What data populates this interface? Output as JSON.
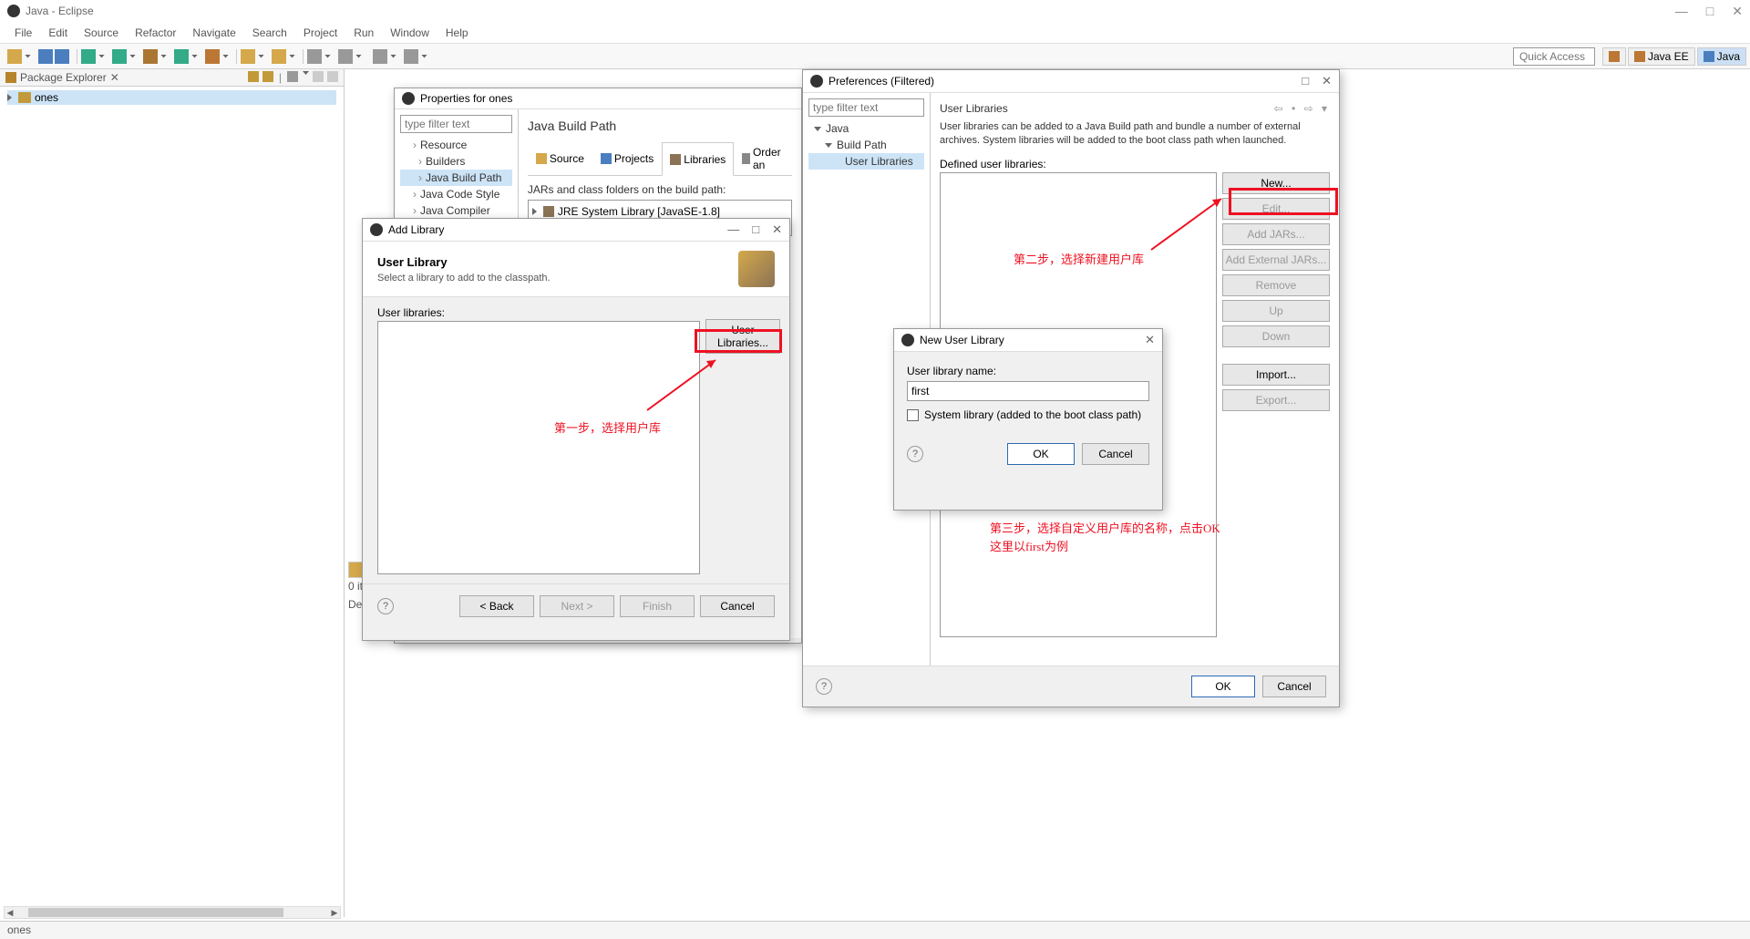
{
  "window": {
    "title": "Java - Eclipse",
    "minimize": "—",
    "maximize": "□",
    "close": "✕"
  },
  "menubar": {
    "items": [
      "File",
      "Edit",
      "Source",
      "Refactor",
      "Navigate",
      "Search",
      "Project",
      "Run",
      "Window",
      "Help"
    ]
  },
  "toolbar": {
    "quick_access": "Quick Access",
    "perspectives": {
      "javaee": "Java EE",
      "java": "Java"
    }
  },
  "package_explorer": {
    "title": "Package Explorer",
    "close_char": "✕",
    "project": "ones"
  },
  "properties_dialog": {
    "title": "Properties for ones",
    "filter_placeholder": "type filter text",
    "tree": {
      "resource": "Resource",
      "builders": "Builders",
      "build_path": "Java Build Path",
      "code_style": "Java Code Style",
      "compiler": "Java Compiler"
    },
    "heading": "Java Build Path",
    "tabs": {
      "source": "Source",
      "projects": "Projects",
      "libraries": "Libraries",
      "order": "Order an"
    },
    "desc": "JARs and class folders on the build path:",
    "jre": "JRE System Library [JavaSE-1.8]"
  },
  "add_library_dialog": {
    "title": "Add Library",
    "heading": "User Library",
    "subheading": "Select a library to add to the classpath.",
    "list_label": "User libraries:",
    "user_libs_btn": "User Libraries...",
    "back": "< Back",
    "next": "Next >",
    "finish": "Finish",
    "cancel": "Cancel"
  },
  "preferences_dialog": {
    "title": "Preferences (Filtered)",
    "filter_placeholder": "type filter text",
    "tree": {
      "java": "Java",
      "build_path": "Build Path",
      "user_libs": "User Libraries"
    },
    "heading": "User Libraries",
    "description": "User libraries can be added to a Java Build path and bundle a number of external archives. System libraries will be added to the boot class path when launched.",
    "defined_label": "Defined user libraries:",
    "buttons": {
      "new": "New...",
      "edit": "Edit...",
      "add_jars": "Add JARs...",
      "add_ext_jars": "Add External JARs...",
      "remove": "Remove",
      "up": "Up",
      "down": "Down",
      "import": "Import...",
      "export": "Export..."
    },
    "ok": "OK",
    "cancel": "Cancel"
  },
  "new_user_library_dialog": {
    "title": "New User Library",
    "name_label": "User library name:",
    "name_value": "first",
    "system_lib_label": "System library (added to the boot class path)",
    "ok": "OK",
    "cancel": "Cancel"
  },
  "annotations": {
    "step1": "第一步，选择用户库",
    "step2": "第二步，选择新建用户库",
    "step3": "第三步，选择自定义用户库的名称，点击OK\n这里以first为例"
  },
  "statusbar": {
    "text": "ones",
    "items_label": "0 it",
    "desc_label": "De"
  }
}
